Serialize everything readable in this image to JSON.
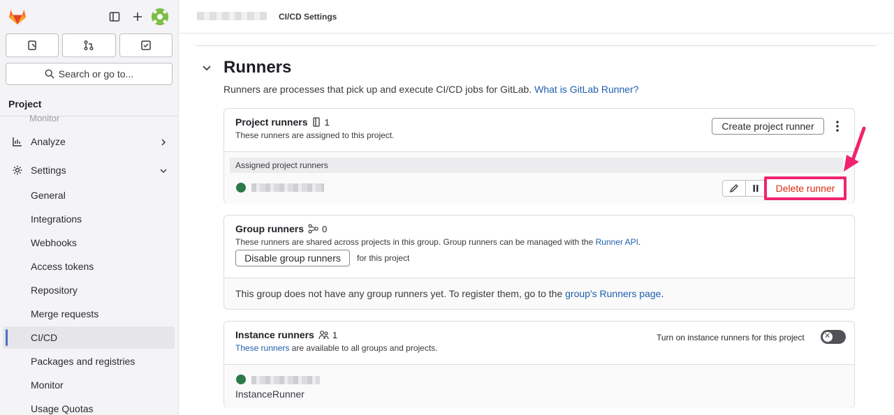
{
  "header": {
    "breadcrumb_current": "CI/CD Settings"
  },
  "sidebar": {
    "search_label": "Search or go to...",
    "section_title": "Project",
    "cut_item": "Monitor",
    "analyze": "Analyze",
    "settings": "Settings",
    "sub_items": [
      "General",
      "Integrations",
      "Webhooks",
      "Access tokens",
      "Repository",
      "Merge requests",
      "CI/CD",
      "Packages and registries",
      "Monitor",
      "Usage Quotas"
    ]
  },
  "runners": {
    "title": "Runners",
    "desc": "Runners are processes that pick up and execute CI/CD jobs for GitLab.",
    "desc_link": "What is GitLab Runner?"
  },
  "project_runners": {
    "title": "Project runners",
    "count": "1",
    "sub": "These runners are assigned to this project.",
    "create_btn": "Create project runner",
    "assigned_label": "Assigned project runners",
    "delete_btn": "Delete runner"
  },
  "group_runners": {
    "title": "Group runners",
    "count": "0",
    "sub": "These runners are shared across projects in this group. Group runners can be managed with the",
    "sub_link": "Runner API",
    "sub_end": ".",
    "disable_btn": "Disable group runners",
    "for_project": "for this project",
    "empty_text": "This group does not have any group runners yet. To register them, go to the",
    "empty_link": "group's Runners page",
    "empty_end": "."
  },
  "instance_runners": {
    "title": "Instance runners",
    "count": "1",
    "sub_link": "These runners",
    "sub": "are available to all groups and projects.",
    "toggle_label": "Turn on instance runners for this project",
    "runner_name": "InstanceRunner"
  },
  "colors": {
    "highlight": "#f0246e",
    "delete_text": "#dd2b0e",
    "link": "#1f5fad",
    "status_online": "#2c7a4b"
  }
}
